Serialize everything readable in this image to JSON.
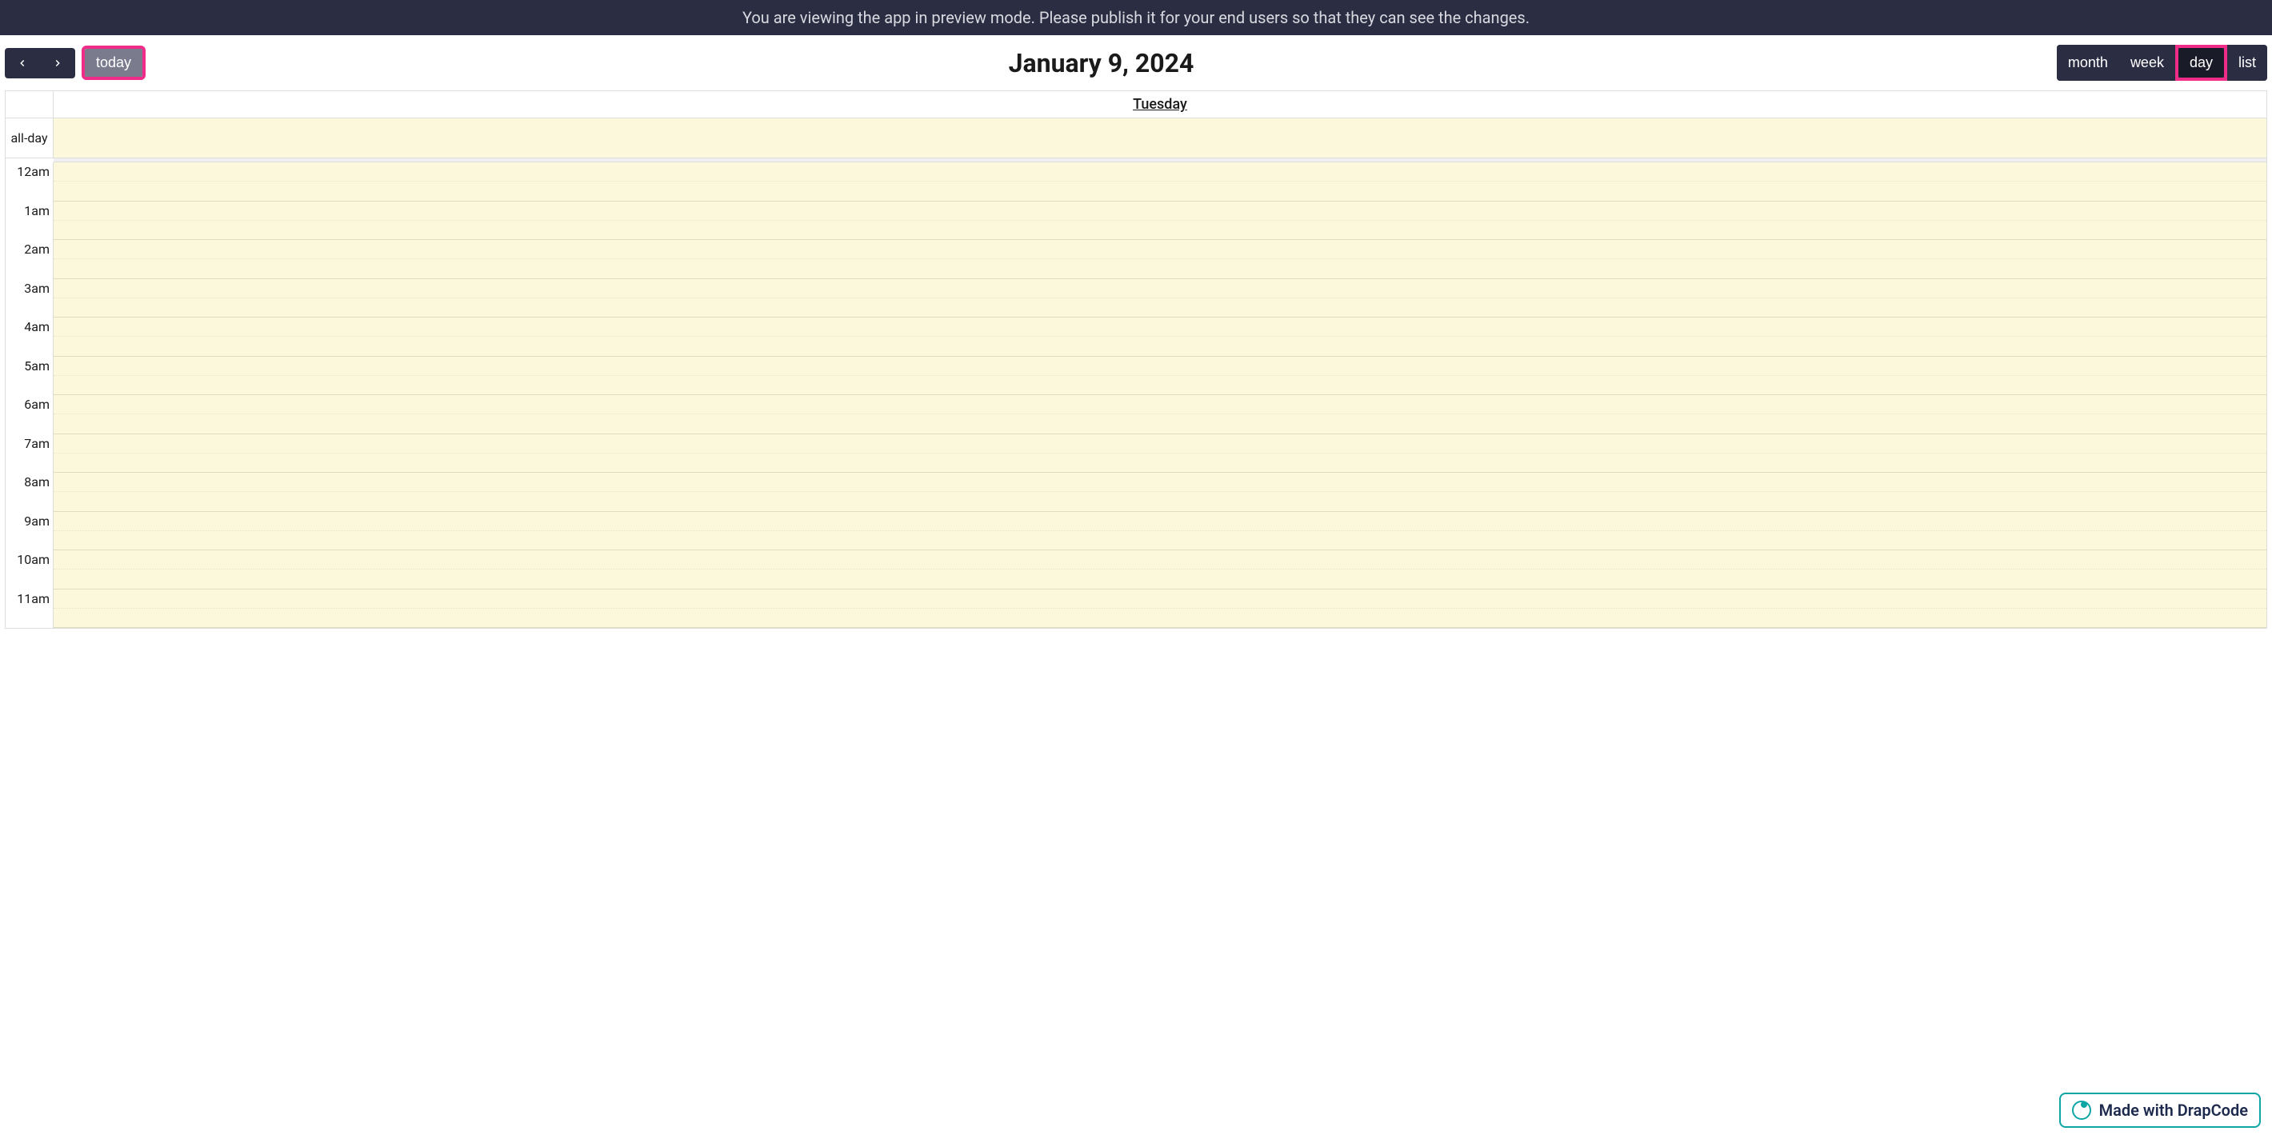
{
  "banner": {
    "message": "You are viewing the app in preview mode. Please publish it for your end users so that they can see the changes."
  },
  "toolbar": {
    "today_label": "today",
    "title": "January 9, 2024",
    "views": {
      "month": "month",
      "week": "week",
      "day": "day",
      "list": "list"
    },
    "active_view": "day"
  },
  "calendar": {
    "day_header": "Tuesday",
    "allday_label": "all-day",
    "time_slots": [
      "12am",
      "1am",
      "2am",
      "3am",
      "4am",
      "5am",
      "6am",
      "7am",
      "8am",
      "9am",
      "10am",
      "11am"
    ]
  },
  "badge": {
    "text": "Made with DrapCode"
  }
}
